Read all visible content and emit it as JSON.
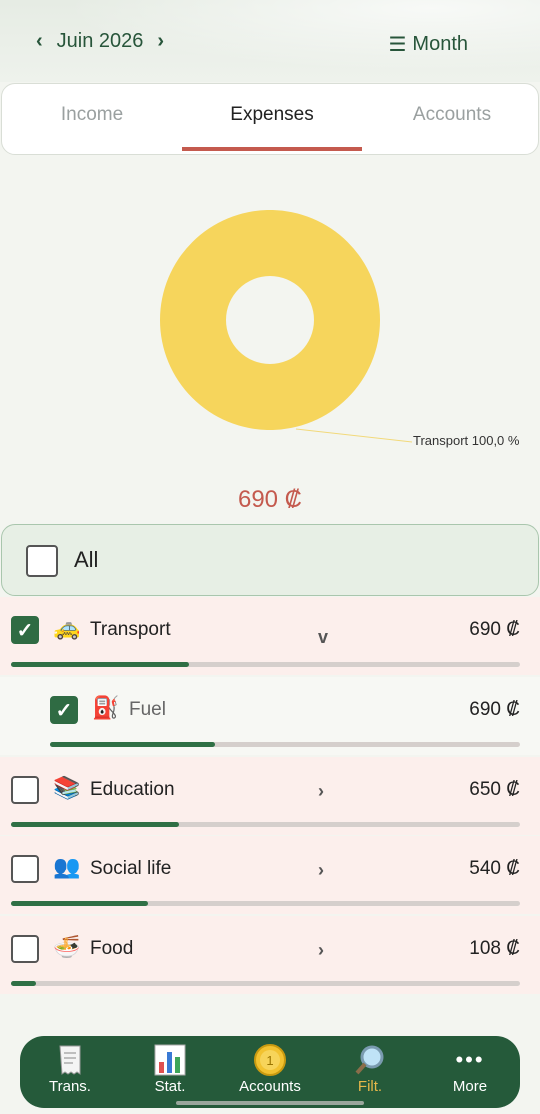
{
  "header": {
    "month": "Juin 2026",
    "period": "Month"
  },
  "tabs": [
    {
      "label": "Income"
    },
    {
      "label": "Expenses"
    },
    {
      "label": "Accounts"
    }
  ],
  "chart_data": {
    "type": "pie",
    "categories": [
      "Transport"
    ],
    "values": [
      100.0
    ],
    "labels": [
      "Transport  100,0 %"
    ],
    "colors": [
      "#f6d55c"
    ]
  },
  "total": "690 ₡",
  "all_label": "All",
  "rows": [
    {
      "label": "Transport",
      "amount": "690 ₡",
      "emoji": "🚕",
      "checked": true,
      "expanded": true,
      "level": 0,
      "fill": 0.35
    },
    {
      "label": "Fuel",
      "amount": "690 ₡",
      "emoji": "⛽",
      "checked": true,
      "level": 1,
      "fill": 0.35
    },
    {
      "label": "Education",
      "amount": "650 ₡",
      "emoji": "📚",
      "checked": false,
      "level": 0,
      "fill": 0.33
    },
    {
      "label": "Social life",
      "amount": "540 ₡",
      "emoji": "👥",
      "checked": false,
      "level": 0,
      "fill": 0.27
    },
    {
      "label": "Food",
      "amount": "108 ₡",
      "emoji": "🍜",
      "checked": false,
      "level": 0,
      "fill": 0.05
    }
  ],
  "bottom_nav": [
    {
      "label": "Trans.",
      "icon": "receipt-icon"
    },
    {
      "label": "Stat.",
      "icon": "bar-chart-icon"
    },
    {
      "label": "Accounts",
      "icon": "coin-icon"
    },
    {
      "label": "Filt.",
      "icon": "magnifier-icon",
      "active": true
    },
    {
      "label": "More",
      "icon": "more-dots-icon"
    }
  ]
}
